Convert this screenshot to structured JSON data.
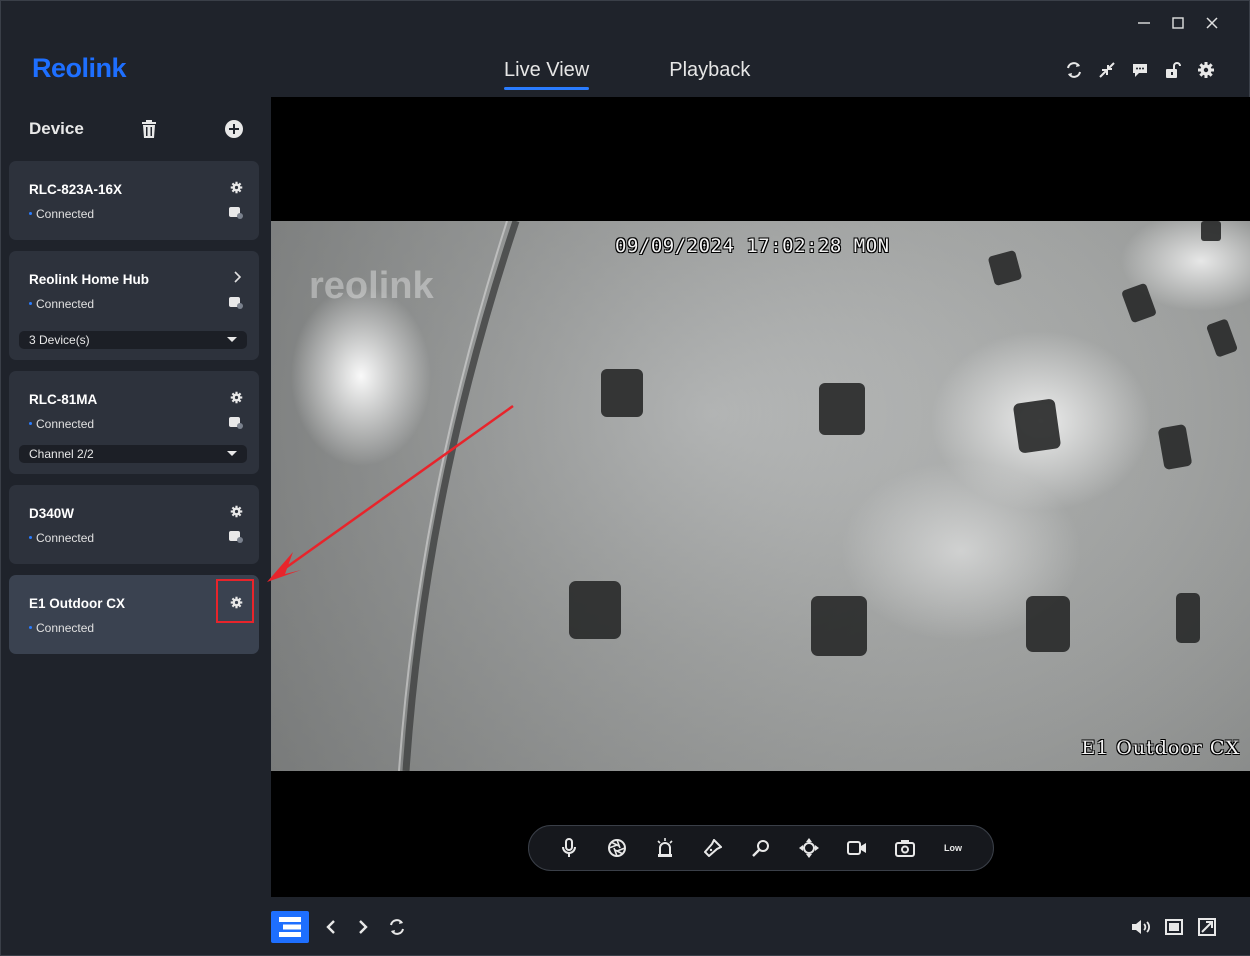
{
  "app": {
    "logo": "Reolink",
    "tabs": [
      {
        "label": "Live View",
        "active": true
      },
      {
        "label": "Playback",
        "active": false
      }
    ],
    "header_icons": [
      "sync-icon",
      "collapse-icon",
      "message-icon",
      "lock-icon",
      "settings-icon"
    ]
  },
  "sidebar": {
    "title": "Device",
    "devices": [
      {
        "name": "RLC-823A-16X",
        "status": "Connected",
        "action": "gear"
      },
      {
        "name": "Reolink Home Hub",
        "status": "Connected",
        "action": "chevron",
        "dropdown": "3 Device(s)"
      },
      {
        "name": "RLC-81MA",
        "status": "Connected",
        "action": "gear",
        "dropdown": "Channel 2/2"
      },
      {
        "name": "D340W",
        "status": "Connected",
        "action": "gear"
      },
      {
        "name": "E1 Outdoor CX",
        "status": "Connected",
        "action": "gear",
        "selected": true
      }
    ]
  },
  "video": {
    "timestamp": "09/09/2024 17:02:28 MON",
    "camera_name": "E1 Outdoor CX",
    "watermark": "reolink",
    "toolbar": {
      "buttons": [
        "microphone-icon",
        "aperture-icon",
        "siren-icon",
        "flashlight-icon",
        "zoom-icon",
        "ptz-icon",
        "record-icon",
        "snapshot-icon"
      ],
      "quality_label": "Low"
    }
  },
  "colors": {
    "accent": "#1e6fff",
    "background": "#1f232b",
    "card": "#2d323c",
    "highlight": "#e8242b"
  }
}
